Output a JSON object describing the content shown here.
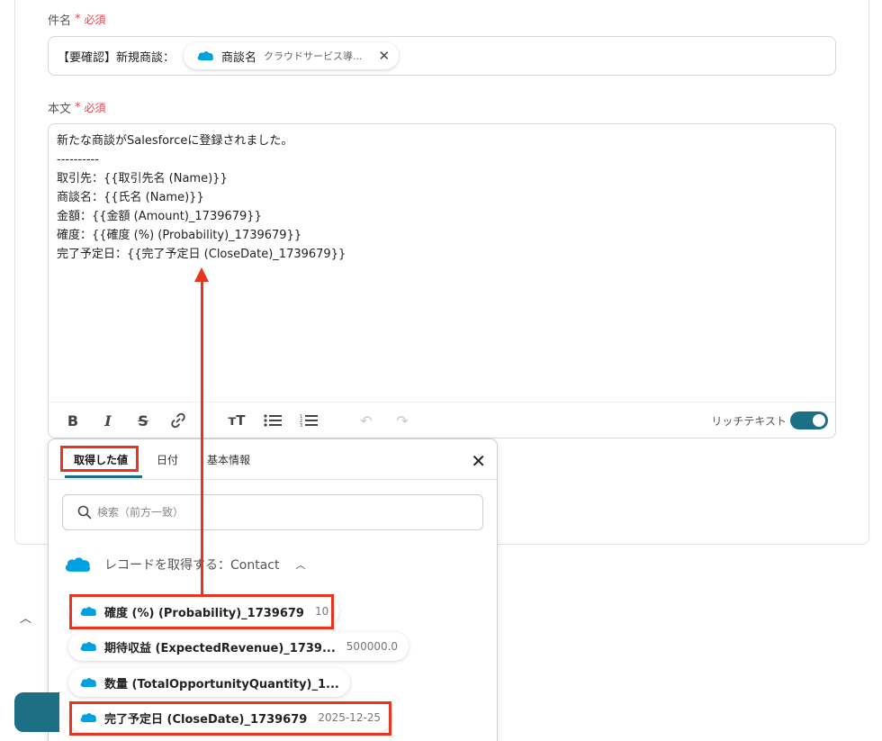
{
  "subject": {
    "label": "件名",
    "required_mark": "*",
    "required_text": "必須",
    "prefix": "【要確認】新規商談：",
    "chip": {
      "label": "商談名",
      "value": "クラウドサービス導..."
    }
  },
  "body": {
    "label": "本文",
    "required_mark": "*",
    "required_text": "必須",
    "lines": [
      "新たな商談がSalesforceに登録されました。",
      "----------",
      "取引先：{{取引先名 (Name)}}",
      "商談名：{{氏名 (Name)}}",
      "金額：{{金額 (Amount)_1739679}}",
      "確度：{{確度 (%) (Probability)_1739679}}",
      "完了予定日：{{完了予定日 (CloseDate)_1739679}}"
    ]
  },
  "toolbar": {
    "rich_text_label": "リッチテキスト",
    "rich_text_enabled": true
  },
  "popup": {
    "tabs": [
      {
        "label": "取得した値",
        "active": true
      },
      {
        "label": "日付",
        "active": false
      },
      {
        "label": "基本情報",
        "active": false
      }
    ],
    "search_placeholder": "検索（前方一致）",
    "group_title": "レコードを取得する：Contact",
    "items": [
      {
        "label": "確度 (%) (Probability)_1739679",
        "value": "10"
      },
      {
        "label": "期待収益 (ExpectedRevenue)_1739...",
        "value": "500000.0"
      },
      {
        "label": "数量 (TotalOpportunityQuantity)_1...",
        "value": ""
      },
      {
        "label": "完了予定日 (CloseDate)_1739679",
        "value": "2025-12-25"
      }
    ]
  },
  "colors": {
    "accent": "#1d6f86",
    "highlight": "#e8351e",
    "required": "#e5484d",
    "salesforce": "#00a1e0"
  }
}
